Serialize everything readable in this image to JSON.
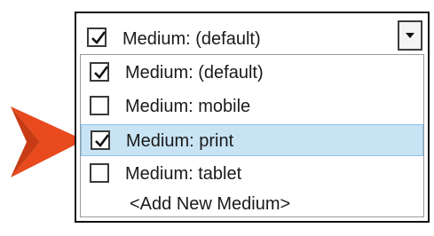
{
  "selector": {
    "current_value": "Medium: (default)",
    "current_checked": true
  },
  "items": [
    {
      "label": "Medium: (default)",
      "checked": true,
      "highlighted": false
    },
    {
      "label": "Medium: mobile",
      "checked": false,
      "highlighted": false
    },
    {
      "label": "Medium: print",
      "checked": true,
      "highlighted": true
    },
    {
      "label": "Medium: tablet",
      "checked": false,
      "highlighted": false
    }
  ],
  "add_item_label": "<Add New Medium>",
  "colors": {
    "arrow": "#e8491d",
    "highlight": "#c8e3f4",
    "highlight_border": "#8cc2e8"
  },
  "icons": {
    "pointer": "arrow-pointer-icon",
    "dropdown": "chevron-down-icon",
    "check": "checkmark-icon"
  }
}
